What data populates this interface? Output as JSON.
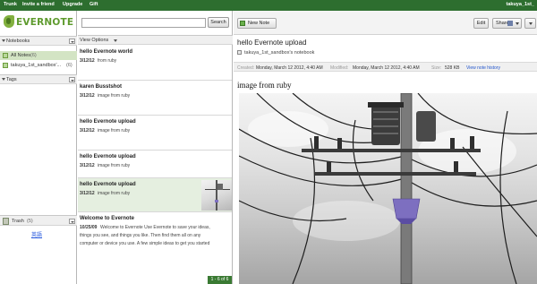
{
  "topbar": {
    "links": [
      "Trunk",
      "Invite a friend",
      "Upgrade",
      "Gift"
    ],
    "username": "takuya_1st_"
  },
  "sidebar": {
    "logo_text": "EVERNOTE",
    "notebooks_label": "Notebooks",
    "notebooks": [
      {
        "name": "All Notes",
        "count": "(6)"
      },
      {
        "name": "takuya_1st_sandbox'...",
        "count": "(6)"
      }
    ],
    "tags_label": "Tags",
    "trash_label": "Trash",
    "trash_count": "(5)",
    "language_link": "英語"
  },
  "notelist": {
    "search_placeholder": "",
    "search_button": "Search",
    "view_options": "View Options",
    "notes": [
      {
        "title": "hello Evernote world",
        "date": "3/12/12",
        "snippet": "from ruby"
      },
      {
        "title": "karen Busstshot",
        "date": "3/12/12",
        "snippet": "image from ruby"
      },
      {
        "title": "hello Evernote upload",
        "date": "3/12/12",
        "snippet": "image from ruby"
      },
      {
        "title": "hello Evernote upload",
        "date": "3/12/12",
        "snippet": "image from ruby"
      },
      {
        "title": "hello Evernote upload",
        "date": "3/12/12",
        "snippet": "image from ruby"
      },
      {
        "title": "Welcome to Evernote",
        "date": "10/25/09",
        "snippet": "Welcome to Evernote Use Evernote to save your ideas,",
        "line2": "things you see, and things you like. Then find them all on any",
        "line3": "computer or device you use. A few simple ideas to get you started"
      }
    ],
    "pager": "1 - 6 of 6"
  },
  "toolbar": {
    "new_note": "New Note",
    "edit": "Edit",
    "share": "Share",
    "share_fb": "f"
  },
  "note": {
    "title": "hello Evernote upload",
    "notebook": "takuya_1st_sandbox's notebook",
    "created_label": "Created:",
    "created_value": "Monday, March 12 2012, 4:40 AM",
    "modified_label": "Modified:",
    "modified_value": "Monday, March 12 2012, 4:40 AM",
    "size_label": "Size:",
    "size_value": "528 KB",
    "history_link": "View note history",
    "body_text": "image from ruby"
  },
  "colors": {
    "topbar": "#2d6e2f",
    "accent_green": "#5f9b2f",
    "selection": "#d3e4c4",
    "insulator_band": "#7d6fc0"
  }
}
